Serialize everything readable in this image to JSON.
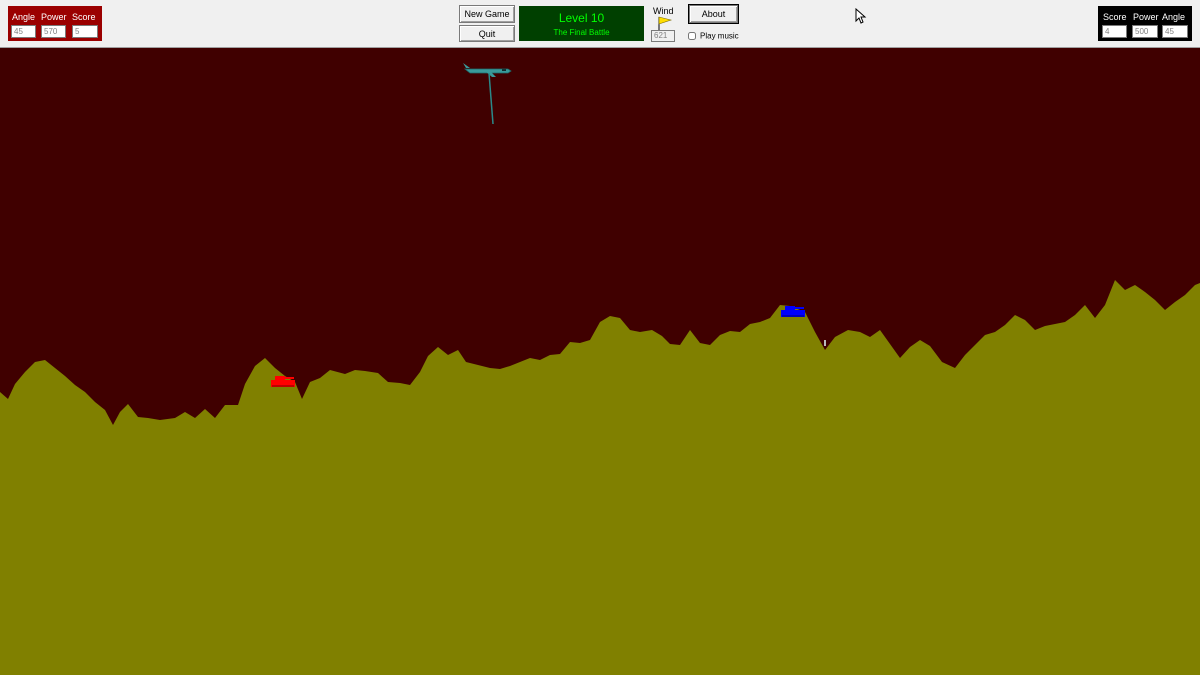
{
  "player_left": {
    "angle_label": "Angle",
    "power_label": "Power",
    "score_label": "Score",
    "angle": "45",
    "power": "570",
    "score": "5",
    "color": "#9b0000"
  },
  "player_right": {
    "score_label": "Score",
    "power_label": "Power",
    "angle_label": "Angle",
    "score": "4",
    "power": "500",
    "angle": "45",
    "color": "#000000"
  },
  "buttons": {
    "new_game": "New Game",
    "quit": "Quit",
    "about": "About"
  },
  "level": {
    "title": "Level 10",
    "subtitle": "The Final Battle"
  },
  "wind": {
    "label": "Wind",
    "value": "621",
    "icon": "flag-icon"
  },
  "music": {
    "label": "Play music",
    "checked": false
  },
  "scene": {
    "sky_color": "#400000",
    "ground_color": "#808000",
    "red_tank_color": "#ff0000",
    "blue_tank_color": "#0000ff"
  }
}
